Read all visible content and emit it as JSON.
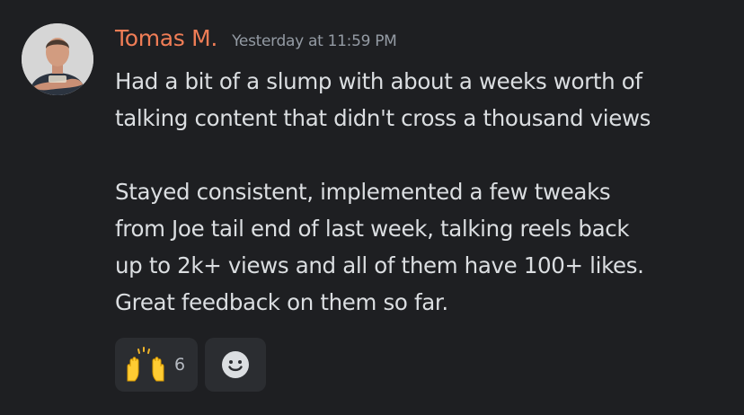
{
  "message": {
    "author": "Tomas M.",
    "timestamp": "Yesterday at 11:59 PM",
    "lines": [
      "Had a bit of a slump with about a weeks worth of",
      "talking content that didn't cross a thousand views",
      "",
      "Stayed consistent, implemented a few tweaks",
      "from Joe tail end of last week, talking reels back",
      "up to 2k+ views and all of them have 100+ likes.",
      "Great feedback on them so far."
    ]
  },
  "reactions": [
    {
      "icon": "raising-hands-emoji",
      "count": "6"
    },
    {
      "icon": "add-reaction-smiley-icon"
    }
  ],
  "colors": {
    "background": "#1e1f22",
    "author": "#f07d56",
    "timestamp": "#949ba4",
    "text": "#dbdee1",
    "reaction_bg": "#2b2d31"
  }
}
